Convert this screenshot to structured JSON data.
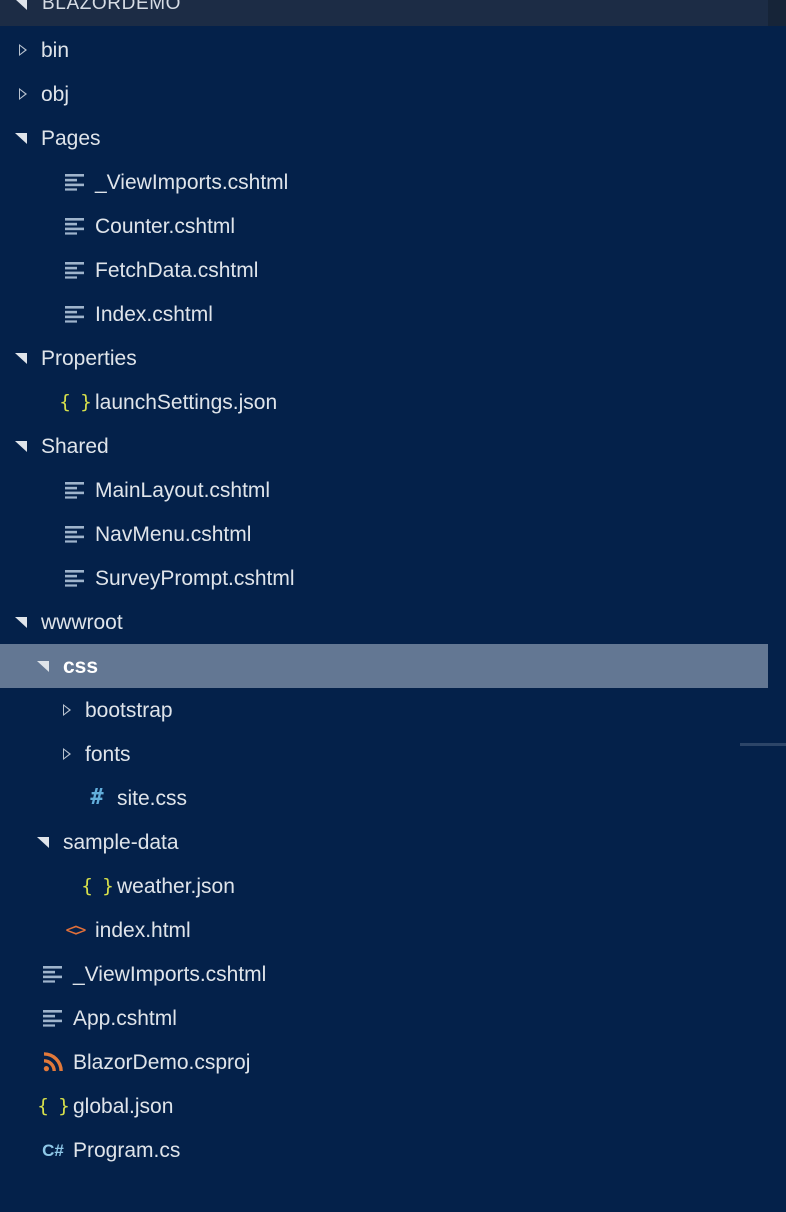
{
  "panel": {
    "name": "file-explorer",
    "background_color": "#04214a",
    "selected_row_color": "#637793",
    "header_background_color": "#1c2c45",
    "text_color": "#dfe4ea"
  },
  "header": {
    "title": "BLAZORDEMO",
    "twisty": "expanded"
  },
  "tree": {
    "items": [
      {
        "label": "bin",
        "depth": 0,
        "kind": "folder",
        "twisty": "collapsed",
        "icon": "chevron-right-icon",
        "selected": false
      },
      {
        "label": "obj",
        "depth": 0,
        "kind": "folder",
        "twisty": "collapsed",
        "icon": "chevron-right-icon",
        "selected": false
      },
      {
        "label": "Pages",
        "depth": 0,
        "kind": "folder",
        "twisty": "expanded",
        "icon": "chevron-down-icon",
        "selected": false
      },
      {
        "label": "_ViewImports.cshtml",
        "depth": 1,
        "kind": "file",
        "twisty": "none",
        "icon": "razor-file-icon",
        "selected": false
      },
      {
        "label": "Counter.cshtml",
        "depth": 1,
        "kind": "file",
        "twisty": "none",
        "icon": "razor-file-icon",
        "selected": false
      },
      {
        "label": "FetchData.cshtml",
        "depth": 1,
        "kind": "file",
        "twisty": "none",
        "icon": "razor-file-icon",
        "selected": false
      },
      {
        "label": "Index.cshtml",
        "depth": 1,
        "kind": "file",
        "twisty": "none",
        "icon": "razor-file-icon",
        "selected": false
      },
      {
        "label": "Properties",
        "depth": 0,
        "kind": "folder",
        "twisty": "expanded",
        "icon": "chevron-down-icon",
        "selected": false
      },
      {
        "label": "launchSettings.json",
        "depth": 1,
        "kind": "file",
        "twisty": "none",
        "icon": "json-file-icon",
        "selected": false
      },
      {
        "label": "Shared",
        "depth": 0,
        "kind": "folder",
        "twisty": "expanded",
        "icon": "chevron-down-icon",
        "selected": false
      },
      {
        "label": "MainLayout.cshtml",
        "depth": 1,
        "kind": "file",
        "twisty": "none",
        "icon": "razor-file-icon",
        "selected": false
      },
      {
        "label": "NavMenu.cshtml",
        "depth": 1,
        "kind": "file",
        "twisty": "none",
        "icon": "razor-file-icon",
        "selected": false
      },
      {
        "label": "SurveyPrompt.cshtml",
        "depth": 1,
        "kind": "file",
        "twisty": "none",
        "icon": "razor-file-icon",
        "selected": false
      },
      {
        "label": "wwwroot",
        "depth": 0,
        "kind": "folder",
        "twisty": "expanded",
        "icon": "chevron-down-icon",
        "selected": false
      },
      {
        "label": "css",
        "depth": 1,
        "kind": "folder",
        "twisty": "expanded",
        "icon": "chevron-down-icon",
        "selected": true
      },
      {
        "label": "bootstrap",
        "depth": 2,
        "kind": "folder",
        "twisty": "collapsed",
        "icon": "chevron-right-icon",
        "selected": false
      },
      {
        "label": "fonts",
        "depth": 2,
        "kind": "folder",
        "twisty": "collapsed",
        "icon": "chevron-right-icon",
        "selected": false
      },
      {
        "label": "site.css",
        "depth": 2,
        "kind": "file",
        "twisty": "none",
        "icon": "css-file-icon",
        "selected": false
      },
      {
        "label": "sample-data",
        "depth": 1,
        "kind": "folder",
        "twisty": "expanded",
        "icon": "chevron-down-icon",
        "selected": false
      },
      {
        "label": "weather.json",
        "depth": 2,
        "kind": "file",
        "twisty": "none",
        "icon": "json-file-icon",
        "selected": false
      },
      {
        "label": "index.html",
        "depth": 1,
        "kind": "file",
        "twisty": "none",
        "icon": "html-file-icon",
        "selected": false
      },
      {
        "label": "_ViewImports.cshtml",
        "depth": 0,
        "kind": "file",
        "twisty": "none",
        "icon": "razor-file-icon",
        "selected": false
      },
      {
        "label": "App.cshtml",
        "depth": 0,
        "kind": "file",
        "twisty": "none",
        "icon": "razor-file-icon",
        "selected": false
      },
      {
        "label": "BlazorDemo.csproj",
        "depth": 0,
        "kind": "file",
        "twisty": "none",
        "icon": "csproj-file-icon",
        "selected": false
      },
      {
        "label": "global.json",
        "depth": 0,
        "kind": "file",
        "twisty": "none",
        "icon": "json-file-icon",
        "selected": false
      },
      {
        "label": "Program.cs",
        "depth": 0,
        "kind": "file",
        "twisty": "none",
        "icon": "csharp-file-icon",
        "selected": false
      }
    ]
  },
  "icon_glyphs": {
    "json-file-icon": "{ }",
    "html-file-icon": "<>",
    "css-file-icon": "#",
    "csharp-file-icon": "C#"
  },
  "icon_colors": {
    "json-file-icon": "#d7e04b",
    "html-file-icon": "#e2703a",
    "css-file-icon": "#62aedb",
    "csharp-file-icon": "#8fc8e8",
    "razor-file-icon": "#9fb4cc",
    "csproj-file-icon": "#e2793a"
  }
}
